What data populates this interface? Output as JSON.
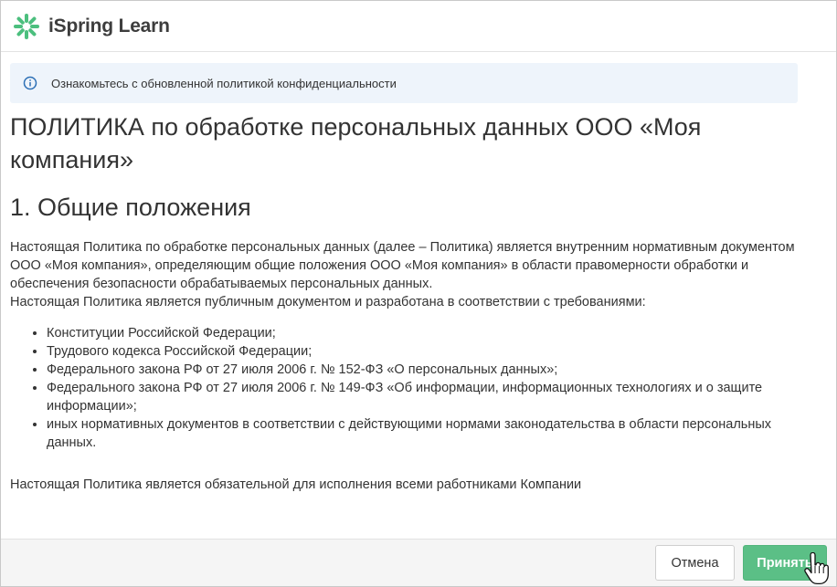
{
  "app": {
    "name": "iSpring Learn"
  },
  "notice": {
    "text": "Ознакомьтесь с обновленной политикой конфиденциальности"
  },
  "document": {
    "title": "ПОЛИТИКА по обработке персональных данных ООО «Моя компания»",
    "section_heading": "1. Общие положения",
    "paragraph_1": "Настоящая Политика по обработке персональных данных (далее – Политика) является внутренним нормативным документом ООО «Моя компания», определяющим общие положения ООО «Моя компания» в области правомерности обработки и обеспечения безопасности обрабатываемых персональных данных.",
    "paragraph_2": "Настоящая Политика является публичным документом и разработана в соответствии с требованиями:",
    "list_items": [
      "Конституции Российской Федерации;",
      "Трудового кодекса Российской Федерации;",
      "Федерального закона РФ от 27 июля 2006 г. № 152-ФЗ «О персональных данных»;",
      "Федерального закона РФ от 27 июля 2006 г. № 149-ФЗ «Об информации, информационных технологиях и о защите информации»;",
      "иных нормативных документов в соответствии с действующими нормами законодательства в области персональных данных."
    ],
    "closing": "Настоящая Политика является обязательной для исполнения всеми работниками Компании"
  },
  "footer": {
    "cancel_label": "Отмена",
    "accept_label": "Принять"
  },
  "colors": {
    "accent": "#5bbf86",
    "notice_bg": "#eef4fb",
    "info_icon": "#2c6fb5"
  }
}
